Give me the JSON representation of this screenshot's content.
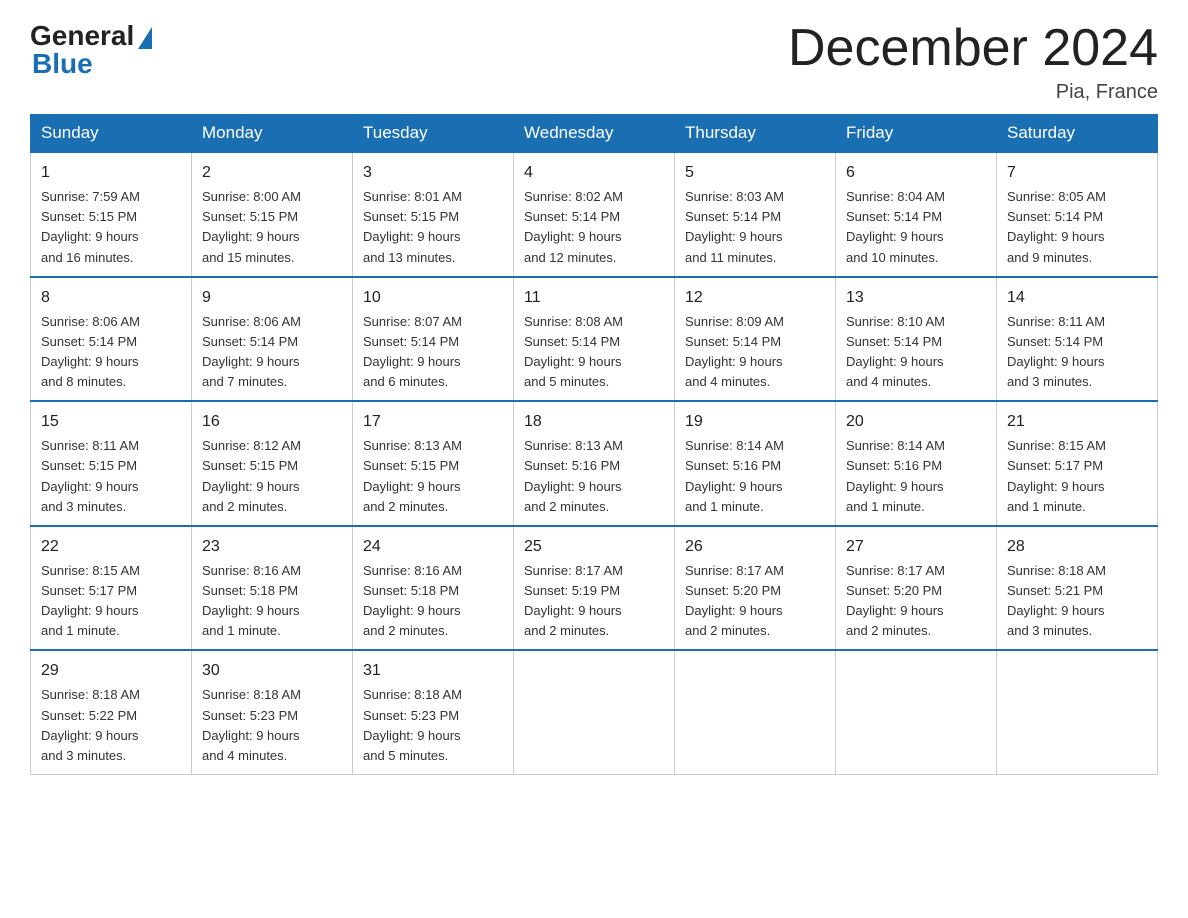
{
  "header": {
    "logo_general": "General",
    "logo_blue": "Blue",
    "title": "December 2024",
    "subtitle": "Pia, France"
  },
  "days_of_week": [
    "Sunday",
    "Monday",
    "Tuesday",
    "Wednesday",
    "Thursday",
    "Friday",
    "Saturday"
  ],
  "weeks": [
    [
      {
        "day": "1",
        "sunrise": "7:59 AM",
        "sunset": "5:15 PM",
        "daylight": "9 hours and 16 minutes."
      },
      {
        "day": "2",
        "sunrise": "8:00 AM",
        "sunset": "5:15 PM",
        "daylight": "9 hours and 15 minutes."
      },
      {
        "day": "3",
        "sunrise": "8:01 AM",
        "sunset": "5:15 PM",
        "daylight": "9 hours and 13 minutes."
      },
      {
        "day": "4",
        "sunrise": "8:02 AM",
        "sunset": "5:14 PM",
        "daylight": "9 hours and 12 minutes."
      },
      {
        "day": "5",
        "sunrise": "8:03 AM",
        "sunset": "5:14 PM",
        "daylight": "9 hours and 11 minutes."
      },
      {
        "day": "6",
        "sunrise": "8:04 AM",
        "sunset": "5:14 PM",
        "daylight": "9 hours and 10 minutes."
      },
      {
        "day": "7",
        "sunrise": "8:05 AM",
        "sunset": "5:14 PM",
        "daylight": "9 hours and 9 minutes."
      }
    ],
    [
      {
        "day": "8",
        "sunrise": "8:06 AM",
        "sunset": "5:14 PM",
        "daylight": "9 hours and 8 minutes."
      },
      {
        "day": "9",
        "sunrise": "8:06 AM",
        "sunset": "5:14 PM",
        "daylight": "9 hours and 7 minutes."
      },
      {
        "day": "10",
        "sunrise": "8:07 AM",
        "sunset": "5:14 PM",
        "daylight": "9 hours and 6 minutes."
      },
      {
        "day": "11",
        "sunrise": "8:08 AM",
        "sunset": "5:14 PM",
        "daylight": "9 hours and 5 minutes."
      },
      {
        "day": "12",
        "sunrise": "8:09 AM",
        "sunset": "5:14 PM",
        "daylight": "9 hours and 4 minutes."
      },
      {
        "day": "13",
        "sunrise": "8:10 AM",
        "sunset": "5:14 PM",
        "daylight": "9 hours and 4 minutes."
      },
      {
        "day": "14",
        "sunrise": "8:11 AM",
        "sunset": "5:14 PM",
        "daylight": "9 hours and 3 minutes."
      }
    ],
    [
      {
        "day": "15",
        "sunrise": "8:11 AM",
        "sunset": "5:15 PM",
        "daylight": "9 hours and 3 minutes."
      },
      {
        "day": "16",
        "sunrise": "8:12 AM",
        "sunset": "5:15 PM",
        "daylight": "9 hours and 2 minutes."
      },
      {
        "day": "17",
        "sunrise": "8:13 AM",
        "sunset": "5:15 PM",
        "daylight": "9 hours and 2 minutes."
      },
      {
        "day": "18",
        "sunrise": "8:13 AM",
        "sunset": "5:16 PM",
        "daylight": "9 hours and 2 minutes."
      },
      {
        "day": "19",
        "sunrise": "8:14 AM",
        "sunset": "5:16 PM",
        "daylight": "9 hours and 1 minute."
      },
      {
        "day": "20",
        "sunrise": "8:14 AM",
        "sunset": "5:16 PM",
        "daylight": "9 hours and 1 minute."
      },
      {
        "day": "21",
        "sunrise": "8:15 AM",
        "sunset": "5:17 PM",
        "daylight": "9 hours and 1 minute."
      }
    ],
    [
      {
        "day": "22",
        "sunrise": "8:15 AM",
        "sunset": "5:17 PM",
        "daylight": "9 hours and 1 minute."
      },
      {
        "day": "23",
        "sunrise": "8:16 AM",
        "sunset": "5:18 PM",
        "daylight": "9 hours and 1 minute."
      },
      {
        "day": "24",
        "sunrise": "8:16 AM",
        "sunset": "5:18 PM",
        "daylight": "9 hours and 2 minutes."
      },
      {
        "day": "25",
        "sunrise": "8:17 AM",
        "sunset": "5:19 PM",
        "daylight": "9 hours and 2 minutes."
      },
      {
        "day": "26",
        "sunrise": "8:17 AM",
        "sunset": "5:20 PM",
        "daylight": "9 hours and 2 minutes."
      },
      {
        "day": "27",
        "sunrise": "8:17 AM",
        "sunset": "5:20 PM",
        "daylight": "9 hours and 2 minutes."
      },
      {
        "day": "28",
        "sunrise": "8:18 AM",
        "sunset": "5:21 PM",
        "daylight": "9 hours and 3 minutes."
      }
    ],
    [
      {
        "day": "29",
        "sunrise": "8:18 AM",
        "sunset": "5:22 PM",
        "daylight": "9 hours and 3 minutes."
      },
      {
        "day": "30",
        "sunrise": "8:18 AM",
        "sunset": "5:23 PM",
        "daylight": "9 hours and 4 minutes."
      },
      {
        "day": "31",
        "sunrise": "8:18 AM",
        "sunset": "5:23 PM",
        "daylight": "9 hours and 5 minutes."
      },
      null,
      null,
      null,
      null
    ]
  ],
  "labels": {
    "sunrise": "Sunrise:",
    "sunset": "Sunset:",
    "daylight": "Daylight:"
  }
}
